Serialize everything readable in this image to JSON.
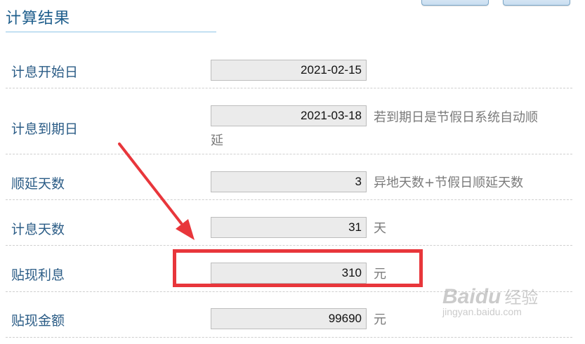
{
  "section": {
    "title": "计算结果"
  },
  "rows": [
    {
      "label": "计息开始日",
      "value": "2021-02-15",
      "note": ""
    },
    {
      "label": "计息到期日",
      "value": "2021-03-18",
      "note": "若到期日是节假日系统自动顺",
      "note_wrap": "延"
    },
    {
      "label": "顺延天数",
      "value": "3",
      "note": "异地天数+节假日顺延天数"
    },
    {
      "label": "计息天数",
      "value": "31",
      "note": "天"
    },
    {
      "label": "贴现利息",
      "value": "310",
      "note": "元"
    },
    {
      "label": "贴现金额",
      "value": "99690",
      "note": "元"
    }
  ],
  "watermark": {
    "brand": "Bai",
    "brand2": "du",
    "cn": "经验",
    "url": "jingyan.baidu.com"
  },
  "colors": {
    "label": "#2b5c86",
    "title": "#1e5e8c",
    "highlight": "#e8363b",
    "arrow": "#e8363b"
  }
}
